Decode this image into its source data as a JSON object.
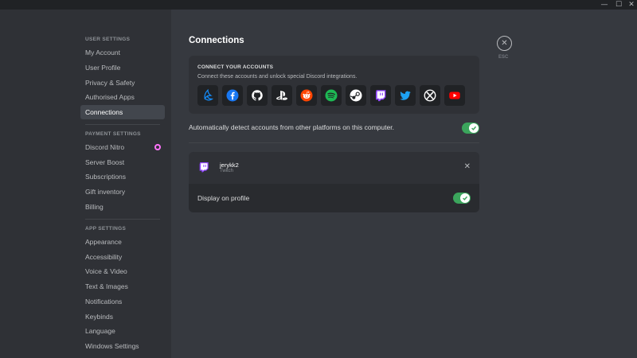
{
  "window": {
    "minimize_glyph": "—",
    "maximize_glyph": "☐",
    "close_glyph": "✕"
  },
  "sidebar": {
    "sections": [
      {
        "header": "USER SETTINGS",
        "items": [
          "My Account",
          "User Profile",
          "Privacy & Safety",
          "Authorised Apps",
          "Connections"
        ]
      },
      {
        "header": "PAYMENT SETTINGS",
        "items": [
          "Discord Nitro",
          "Server Boost",
          "Subscriptions",
          "Gift inventory",
          "Billing"
        ]
      },
      {
        "header": "APP SETTINGS",
        "items": [
          "Appearance",
          "Accessibility",
          "Voice & Video",
          "Text & Images",
          "Notifications",
          "Keybinds",
          "Language",
          "Windows Settings"
        ]
      }
    ],
    "active_item": "Connections"
  },
  "main": {
    "title": "Connections",
    "connect": {
      "title": "CONNECT YOUR ACCOUNTS",
      "subtitle": "Connect these accounts and unlock special Discord integrations.",
      "services": [
        "battlenet-icon",
        "facebook-icon",
        "github-icon",
        "playstation-icon",
        "reddit-icon",
        "spotify-icon",
        "steam-icon",
        "twitch-icon",
        "twitter-icon",
        "xbox-icon",
        "youtube-icon"
      ]
    },
    "auto_detect": {
      "label": "Automatically detect accounts from other platforms on this computer.",
      "enabled": true
    },
    "account": {
      "username": "jerykk2",
      "platform": "Twitch",
      "close_glyph": "✕",
      "display_label": "Display on profile",
      "display_enabled": true
    }
  },
  "esc": {
    "glyph": "✕",
    "label": "ESC"
  },
  "colors": {
    "accent_green": "#3ba55c",
    "twitch_purple": "#9146ff",
    "nitro_pink": "#ff73fa"
  }
}
